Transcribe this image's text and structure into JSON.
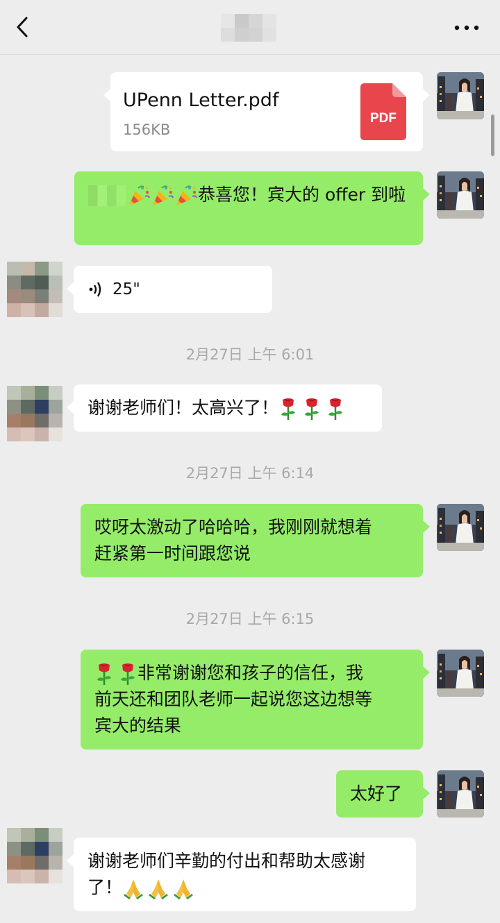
{
  "header": {
    "back_icon": "chevron-left-icon",
    "more_icon": "ellipsis-icon",
    "title_pixelated": true
  },
  "messages": {
    "file": {
      "name": "UPenn Letter.pdf",
      "size": "156KB",
      "badge": "PDF",
      "badge_color": "#e8464c"
    },
    "m1": {
      "text": "恭喜您！宾大的 offer 到啦"
    },
    "voice": {
      "duration": "25\""
    },
    "ts1": "2月27日 上午 6:01",
    "m2": {
      "text": "谢谢老师们！太高兴了！"
    },
    "ts2": "2月27日 上午 6:14",
    "m3": {
      "line1": "哎呀太激动了哈哈哈，我刚刚就想着",
      "line2": "赶紧第一时间跟您说"
    },
    "ts3": "2月27日 上午 6:15",
    "m4": {
      "line1": "非常谢谢您和孩子的信任，我",
      "line2": "前天还和团队老师一起说您这边想等",
      "line3": "宾大的结果"
    },
    "m5": {
      "text": "太好了"
    },
    "m6": {
      "line1": "谢谢老师们辛勤的付出和帮助太感谢",
      "line2": "了！"
    }
  },
  "colors": {
    "self_bubble": "#95ec69",
    "other_bubble": "#ffffff",
    "background": "#ededed"
  }
}
